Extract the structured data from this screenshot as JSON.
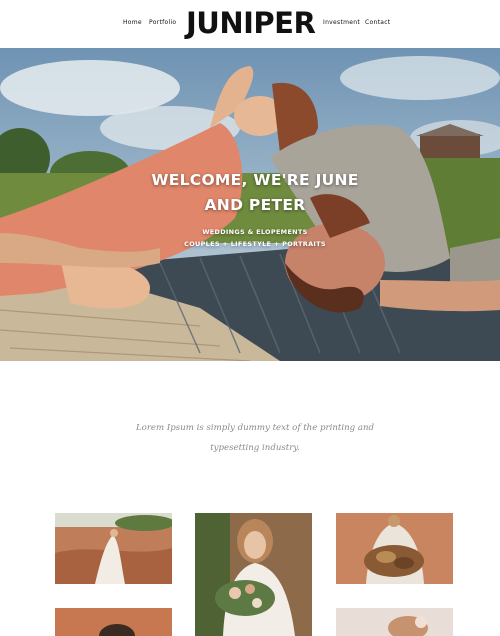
{
  "header": {
    "nav_left": [
      "Home",
      "Portfolio"
    ],
    "logo": "JUNIPER",
    "nav_right": [
      "Investment",
      "Contact"
    ]
  },
  "hero": {
    "title_line1": "WELCOME, WE'RE JUNE",
    "title_line2": "AND PETER",
    "subtitle1": "WEDDINGS & ELOPEMENTS",
    "subtitle2": "COUPLES + LIFESTYLE + PORTRAITS"
  },
  "intro": {
    "line1": "Lorem Ipsum is simply dummy text of the printing and",
    "line2": "typesetting industry."
  },
  "colors": {
    "sky": "#7da1bf",
    "terracotta": "#c07a55",
    "orange_dress": "#e0866a",
    "grey_shirt": "#a9a49a"
  }
}
